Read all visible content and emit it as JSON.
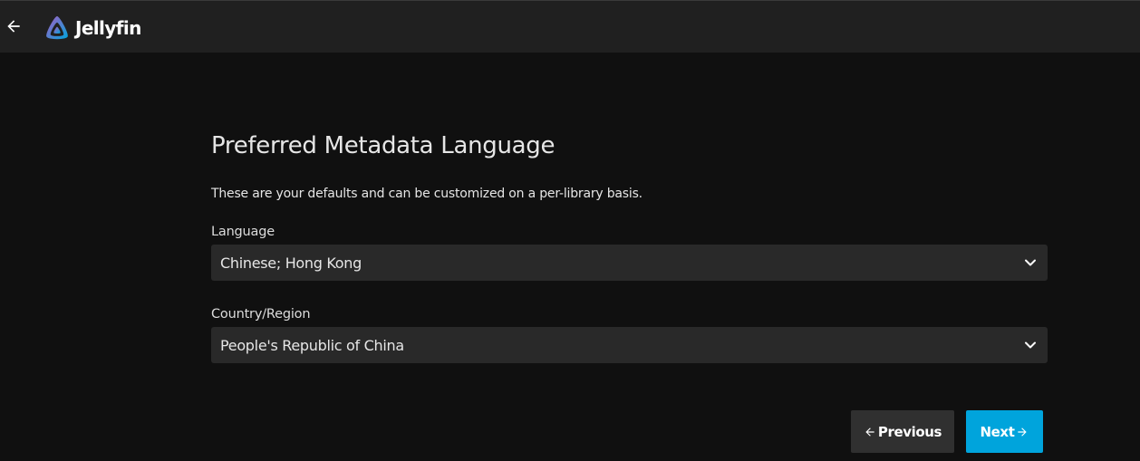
{
  "header": {
    "brand_name": "Jellyfin",
    "back_icon": "arrow-left-icon",
    "logo_icon": "jellyfin-logo-icon"
  },
  "wizard": {
    "title": "Preferred Metadata Language",
    "description": "These are your defaults and can be customized on a per-library basis.",
    "language": {
      "label": "Language",
      "value": "Chinese; Hong Kong"
    },
    "country": {
      "label": "Country/Region",
      "value": "People's Republic of China"
    },
    "buttons": {
      "previous_label": "Previous",
      "next_label": "Next"
    }
  },
  "colors": {
    "header_bg": "#202020",
    "page_bg": "#101010",
    "field_bg": "#292929",
    "accent": "#00a4dc",
    "secondary_button": "#303030"
  }
}
